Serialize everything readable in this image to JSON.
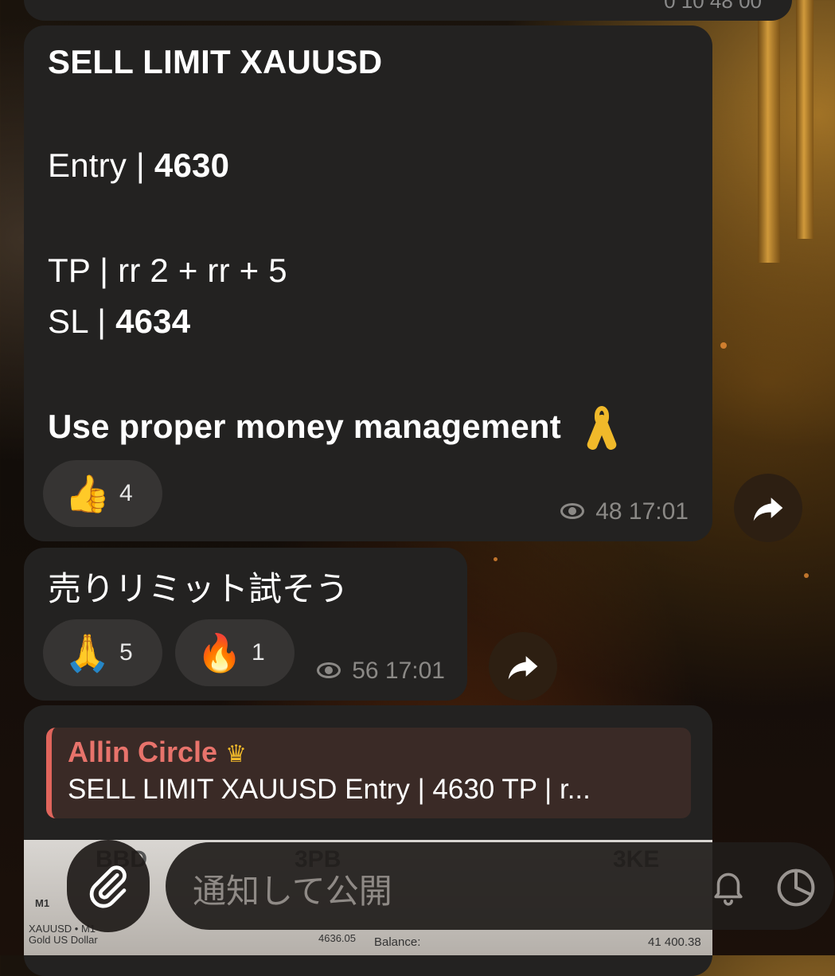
{
  "top_stub": {
    "time": "0 10 48 00"
  },
  "message1": {
    "lines": [
      {
        "plain": "",
        "bold": "SELL LIMIT XAUUSD"
      },
      {
        "plain": "Entry | ",
        "bold": "4630"
      },
      {
        "plain": "TP | rr 2 + rr + 5",
        "bold": ""
      },
      {
        "plain": "SL | ",
        "bold": "4634"
      },
      {
        "plain": "",
        "bold": "Use proper money management"
      }
    ],
    "reaction": {
      "emoji": "👍",
      "count": "4"
    },
    "views": "48",
    "time": "17:01"
  },
  "message2": {
    "text": "売りリミット試そう",
    "reactions": [
      {
        "emoji": "🙏",
        "count": "5"
      },
      {
        "emoji": "🔥",
        "count": "1"
      }
    ],
    "views": "56",
    "time": "17:01"
  },
  "message3": {
    "reply_author": "Allin Circle",
    "reply_quote": "SELL LIMIT XAUUSD Entry | 4630 TP | r...",
    "preview": {
      "tf": "M1",
      "symbol": "XAUUSD • M1",
      "symbol_desc": "Gold US Dollar",
      "price": "4636.05",
      "balance_label": "Balance:",
      "balance_value": "41 400.38"
    }
  },
  "input": {
    "placeholder": "通知して公開"
  },
  "icons": {
    "share": "share-arrow-icon",
    "attach": "paperclip-icon",
    "bell": "bell-icon",
    "timer": "timer-icon",
    "eye": "eye-icon"
  }
}
